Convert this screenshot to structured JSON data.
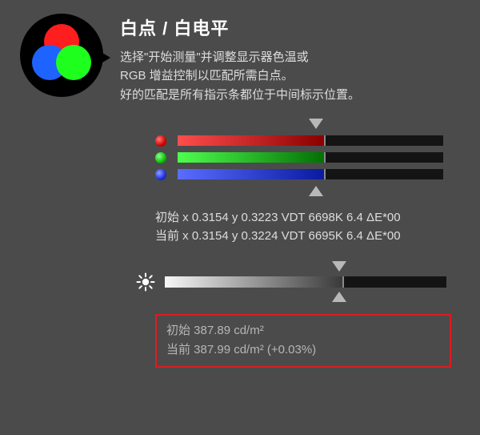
{
  "header": {
    "title": "白点 / 白电平",
    "line1": "选择\"开始测量\"并调整显示器色温或",
    "line2": "RGB 增益控制以匹配所需白点。",
    "line3": "好的匹配是所有指示条都位于中间标示位置。"
  },
  "channels": {
    "red": {
      "name": "red",
      "fill_pct": 55
    },
    "green": {
      "name": "green",
      "fill_pct": 55
    },
    "blue": {
      "name": "blue",
      "fill_pct": 55
    }
  },
  "color_readout": {
    "initial": "初始 x 0.3154 y 0.3223 VDT 6698K 6.4 ΔE*00",
    "current": "当前 x 0.3154 y 0.3224 VDT 6695K 6.4 ΔE*00"
  },
  "brightness": {
    "fill_pct": 63
  },
  "luminance_readout": {
    "initial": "初始 387.89 cd/m²",
    "current": "当前 387.99 cd/m² (+0.03%)"
  },
  "icons": {
    "rgb_logo": "rgb-circles-icon",
    "brightness": "sun-icon"
  }
}
